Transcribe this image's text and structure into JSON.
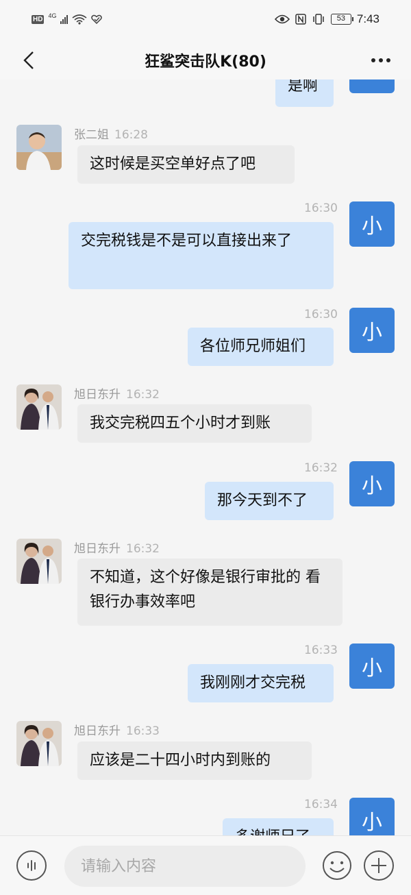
{
  "status_bar": {
    "hd": "HD",
    "network": "4G",
    "battery": "53",
    "time": "7:43"
  },
  "header": {
    "title": "狂鲨突击队K(80)"
  },
  "messages": [
    {
      "from": "self",
      "text": "是啊"
    },
    {
      "from": "other",
      "sender": "张二姐",
      "time": "16:28",
      "text": "这时候是买空单好点了吧"
    },
    {
      "from": "self",
      "avatar_text": "小",
      "time": "16:30",
      "text": "交完税钱是不是可以直接出来了"
    },
    {
      "from": "self",
      "avatar_text": "小",
      "time": "16:30",
      "text": "各位师兄师姐们"
    },
    {
      "from": "other",
      "sender": "旭日东升",
      "time": "16:32",
      "text": "我交完税四五个小时才到账"
    },
    {
      "from": "self",
      "avatar_text": "小",
      "time": "16:32",
      "text": "那今天到不了"
    },
    {
      "from": "other",
      "sender": "旭日东升",
      "time": "16:32",
      "text": "不知道，这个好像是银行审批的 看银行办事效率吧"
    },
    {
      "from": "self",
      "avatar_text": "小",
      "time": "16:33",
      "text": "我刚刚才交完税"
    },
    {
      "from": "other",
      "sender": "旭日东升",
      "time": "16:33",
      "text": "应该是二十四小时内到账的"
    },
    {
      "from": "self",
      "avatar_text": "小",
      "time": "16:34",
      "text": "多谢师兄了"
    }
  ],
  "input": {
    "placeholder": "请输入内容"
  },
  "colors": {
    "self_avatar": "#3b82d9",
    "self_bubble": "#d3e6fb",
    "other_bubble": "#ebebeb"
  }
}
